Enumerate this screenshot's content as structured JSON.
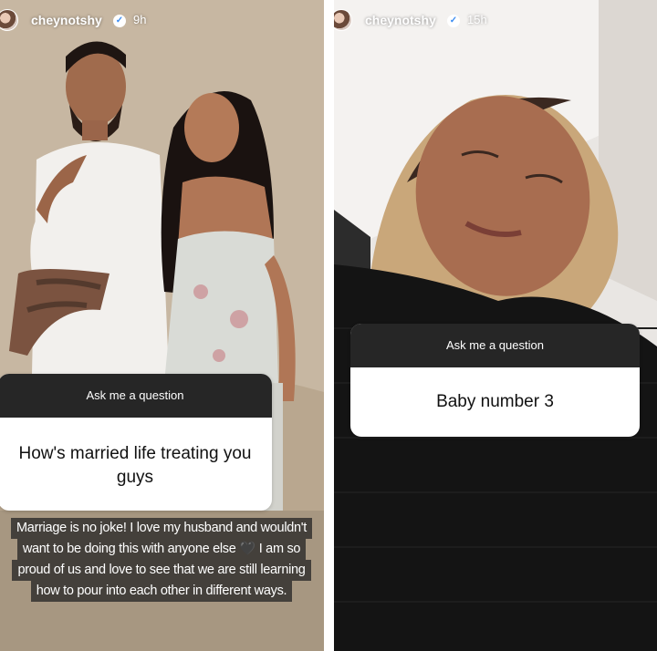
{
  "left_story": {
    "username": "cheynotshy",
    "time_ago": "9h",
    "question_header": "Ask me a question",
    "question_text": "How's married life treating you guys",
    "answer_lines": [
      "Marriage is no joke! I love my husband and wouldn't",
      "want to be doing this with anyone else",
      "I am so",
      "proud of us and love to see that we are still learning",
      "how to pour into each other in different ways."
    ],
    "heart_emoji": "🖤"
  },
  "right_story": {
    "username": "cheynotshy",
    "time_ago": "15h",
    "question_header": "Ask me a question",
    "question_text": "Baby number 3"
  },
  "icons": [
    "verified-badge-icon",
    "profile-avatar"
  ],
  "colors": {
    "sticker_header": "#262626",
    "sticker_body": "#ffffff",
    "verified": "#3b8cf2"
  }
}
